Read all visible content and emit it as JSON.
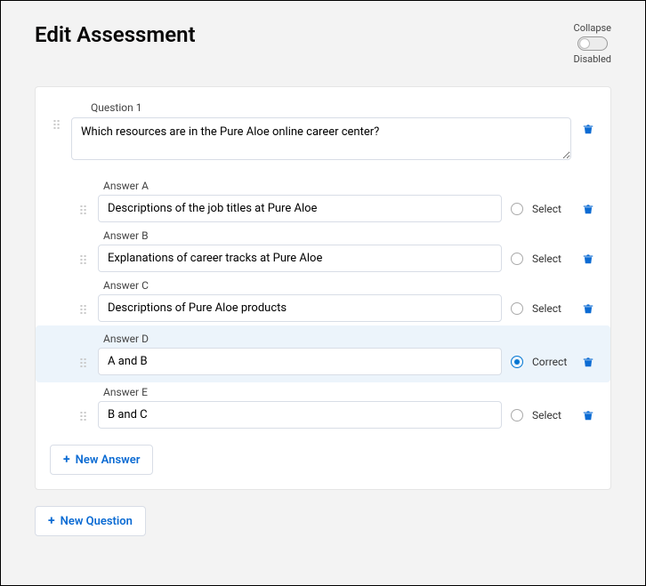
{
  "page": {
    "title": "Edit Assessment"
  },
  "collapse": {
    "title": "Collapse",
    "state": "Disabled"
  },
  "question": {
    "label": "Question 1",
    "text": "Which resources are in the Pure Aloe online career center?"
  },
  "answers": [
    {
      "label": "Answer A",
      "value": "Descriptions of the job titles at Pure Aloe",
      "status": "Select",
      "correct": false
    },
    {
      "label": "Answer B",
      "value": "Explanations of career tracks at Pure Aloe",
      "status": "Select",
      "correct": false
    },
    {
      "label": "Answer C",
      "value": "Descriptions of Pure Aloe products",
      "status": "Select",
      "correct": false
    },
    {
      "label": "Answer D",
      "value": "A and B",
      "status": "Correct",
      "correct": true
    },
    {
      "label": "Answer E",
      "value": "B and C",
      "status": "Select",
      "correct": false
    }
  ],
  "buttons": {
    "new_answer": "New Answer",
    "new_question": "New Question"
  }
}
